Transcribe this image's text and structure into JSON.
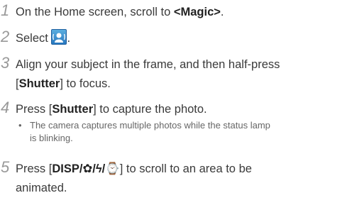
{
  "steps": [
    {
      "num": "1",
      "pre": "On the Home screen, scroll to ",
      "bold": "<Magic>",
      "post": "."
    },
    {
      "num": "2",
      "pre": "Select ",
      "icon": "magic-photo-icon",
      "post": "."
    },
    {
      "num": "3",
      "line1": "Align your subject in the frame, and then half-press",
      "pre": "[",
      "bold": "Shutter",
      "post": "] to focus."
    },
    {
      "num": "4",
      "pre": "Press [",
      "bold": "Shutter",
      "post": "] to capture the photo."
    },
    {
      "num": "5",
      "pre": "Press [",
      "bold": "DISP/✿/ϟ/⌚",
      "post": "] to scroll to an area to be",
      "line2": "animated."
    }
  ],
  "note": {
    "bullet": "•",
    "line1": "The camera captures multiple photos while the status lamp",
    "line2": "is blinking."
  }
}
